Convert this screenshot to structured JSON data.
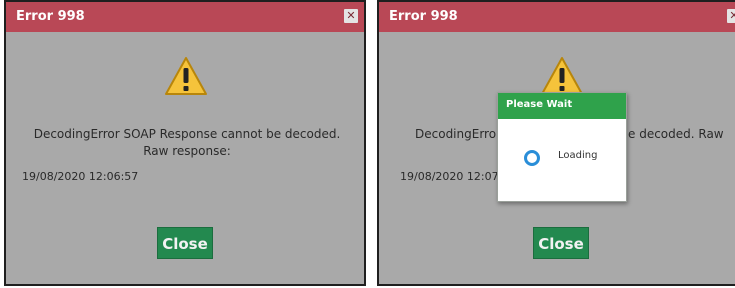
{
  "dialogs": [
    {
      "title": "Error 998",
      "close_icon": "close-x-icon",
      "warning_icon": "warning-triangle-icon",
      "message": "DecodingError SOAP Response cannot be decoded. Raw response:",
      "timestamp": "19/08/2020 12:06:57",
      "button": "Close"
    },
    {
      "title": "Error 998",
      "close_icon": "close-x-icon",
      "warning_icon": "warning-triangle-icon",
      "message_left": "DecodingError S",
      "message_right": "e decoded. Raw",
      "timestamp": "19/08/2020 12:07:1",
      "button": "Close"
    }
  ],
  "wait_dialog": {
    "title": "Please Wait",
    "status": "Loading",
    "spinner_icon": "spinner-icon"
  },
  "colors": {
    "title_bar": "#b94856",
    "dialog_bg": "#a9a9a9",
    "close_button": "#23894f",
    "wait_title_bar": "#2fa24b",
    "spinner": "#2a8ed8"
  }
}
